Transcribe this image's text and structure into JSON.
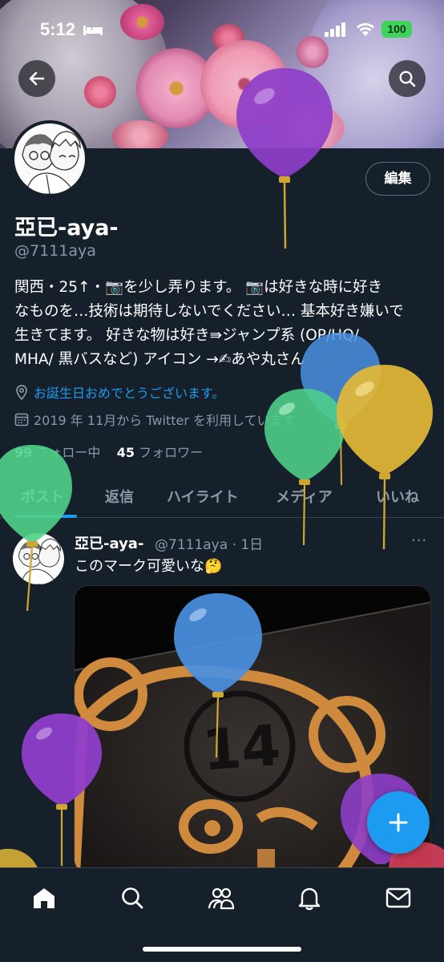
{
  "status_bar": {
    "time": "5:12",
    "battery": "100"
  },
  "profile": {
    "name": "亞已-aya-",
    "handle": "@7111aya",
    "edit_label": "編集",
    "bio_line1": "関西・25↑・📷を少し弄ります。 📷は好きな時に好き",
    "bio_line2": "なものを…技術は期待しないでください… 基本好き嫌いで",
    "bio_line3": "生きてます。 好きな物は好き⇛ジャンプ系 (OP/HQ/",
    "bio_line4": "MHA/ 黒バスなど) アイコン →✍あや丸さん",
    "birthday_text": "お誕生日おめでとうございます。",
    "joined_text": "2019 年 11月から Twitter を利用しています",
    "following_count": "99",
    "following_label": "フォロー中",
    "followers_count": "45",
    "followers_label": "フォロワー"
  },
  "tabs": [
    {
      "label": "ポスト"
    },
    {
      "label": "返信"
    },
    {
      "label": "ハイライト"
    },
    {
      "label": "メディア"
    },
    {
      "label": "いいね"
    }
  ],
  "post": {
    "name": "亞已-aya-",
    "handle_time": "@7111aya · 1日",
    "more": "···",
    "text": "このマーク可愛いな🤔",
    "image_text": "14"
  },
  "icons": {
    "back": "arrow-left-icon",
    "search": "search-icon",
    "fab": "plus-icon",
    "nav": [
      "home-icon",
      "search-icon",
      "communities-icon",
      "bell-icon",
      "mail-icon"
    ]
  },
  "colors": {
    "accent": "#1d9bf0",
    "background": "#15202b",
    "muted": "#8b98a5"
  }
}
